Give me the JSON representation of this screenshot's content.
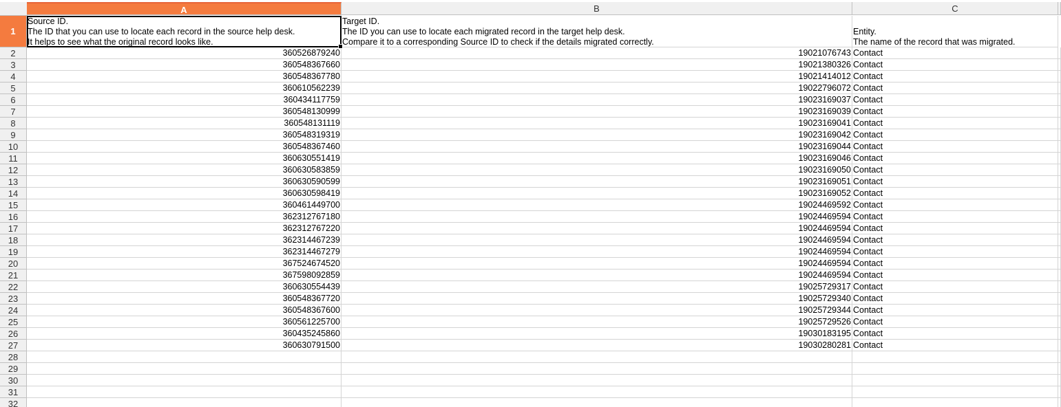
{
  "columns": {
    "a": "A",
    "b": "B",
    "c": "C"
  },
  "header_row": {
    "num": "1",
    "a": [
      "Source ID.",
      "The ID that you can use to locate each record in the source help desk.",
      "It helps to see what the original record looks like."
    ],
    "b": [
      "Target ID.",
      "The ID you can use to locate each migrated record in the target help desk.",
      "Compare it to a corresponding Source ID to check if the details migrated correctly."
    ],
    "c": [
      "",
      "Entity.",
      "The name of the record that was migrated."
    ]
  },
  "rows": [
    {
      "num": "2",
      "a": "360526879240",
      "b": "19021076743",
      "c": "Contact"
    },
    {
      "num": "3",
      "a": "360548367660",
      "b": "19021380326",
      "c": "Contact"
    },
    {
      "num": "4",
      "a": "360548367780",
      "b": "19021414012",
      "c": "Contact"
    },
    {
      "num": "5",
      "a": "360610562239",
      "b": "19022796072",
      "c": "Contact"
    },
    {
      "num": "6",
      "a": "360434117759",
      "b": "19023169037",
      "c": "Contact"
    },
    {
      "num": "7",
      "a": "360548130999",
      "b": "19023169039",
      "c": "Contact"
    },
    {
      "num": "8",
      "a": "360548131119",
      "b": "19023169041",
      "c": "Contact"
    },
    {
      "num": "9",
      "a": "360548319319",
      "b": "19023169042",
      "c": "Contact"
    },
    {
      "num": "10",
      "a": "360548367460",
      "b": "19023169044",
      "c": "Contact"
    },
    {
      "num": "11",
      "a": "360630551419",
      "b": "19023169046",
      "c": "Contact"
    },
    {
      "num": "12",
      "a": "360630583859",
      "b": "19023169050",
      "c": "Contact"
    },
    {
      "num": "13",
      "a": "360630590599",
      "b": "19023169051",
      "c": "Contact"
    },
    {
      "num": "14",
      "a": "360630598419",
      "b": "19023169052",
      "c": "Contact"
    },
    {
      "num": "15",
      "a": "360461449700",
      "b": "19024469592",
      "c": "Contact"
    },
    {
      "num": "16",
      "a": "362312767180",
      "b": "19024469594",
      "c": "Contact"
    },
    {
      "num": "17",
      "a": "362312767220",
      "b": "19024469594",
      "c": "Contact"
    },
    {
      "num": "18",
      "a": "362314467239",
      "b": "19024469594",
      "c": "Contact"
    },
    {
      "num": "19",
      "a": "362314467279",
      "b": "19024469594",
      "c": "Contact"
    },
    {
      "num": "20",
      "a": "367524674520",
      "b": "19024469594",
      "c": "Contact"
    },
    {
      "num": "21",
      "a": "367598092859",
      "b": "19024469594",
      "c": "Contact"
    },
    {
      "num": "22",
      "a": "360630554439",
      "b": "19025729317",
      "c": "Contact"
    },
    {
      "num": "23",
      "a": "360548367720",
      "b": "19025729340",
      "c": "Contact"
    },
    {
      "num": "24",
      "a": "360548367600",
      "b": "19025729344",
      "c": "Contact"
    },
    {
      "num": "25",
      "a": "360561225700",
      "b": "19025729526",
      "c": "Contact"
    },
    {
      "num": "26",
      "a": "360435245860",
      "b": "19030183195",
      "c": "Contact"
    },
    {
      "num": "27",
      "a": "360630791500",
      "b": "19030280281",
      "c": "Contact"
    },
    {
      "num": "28",
      "a": "",
      "b": "",
      "c": ""
    },
    {
      "num": "29",
      "a": "",
      "b": "",
      "c": ""
    },
    {
      "num": "30",
      "a": "",
      "b": "",
      "c": ""
    },
    {
      "num": "31",
      "a": "",
      "b": "",
      "c": ""
    },
    {
      "num": "32",
      "a": "",
      "b": "",
      "c": ""
    }
  ],
  "colors": {
    "selection_header": "#f47b3f",
    "header_bg": "#f0f0f0",
    "grid": "#d4d4d4"
  }
}
